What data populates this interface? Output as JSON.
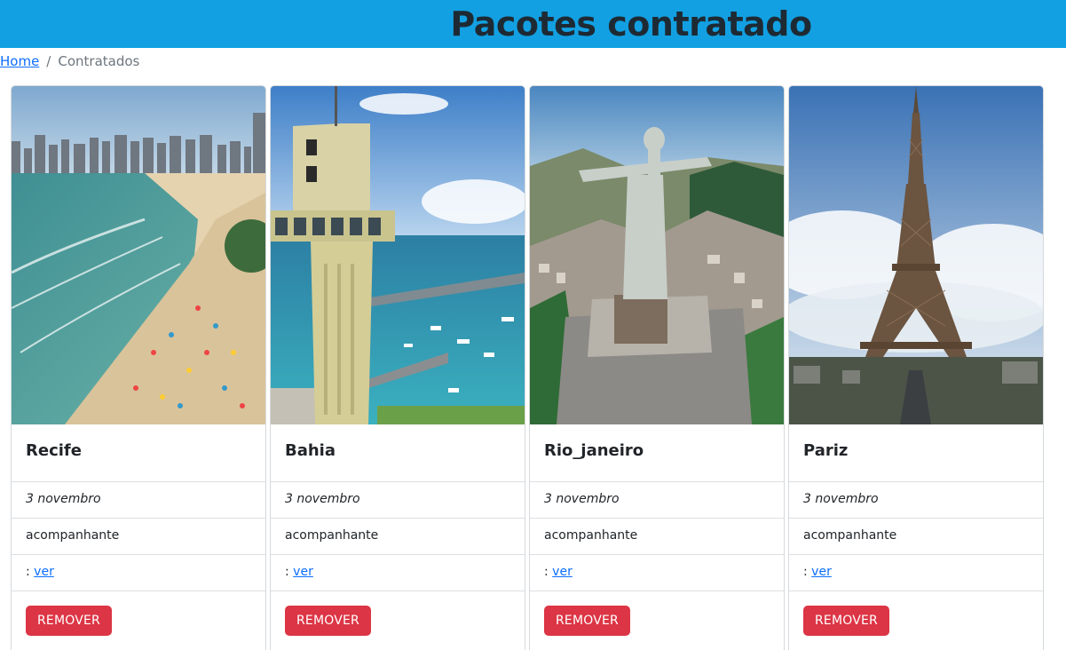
{
  "header": {
    "title": "Pacotes contratado"
  },
  "breadcrumb": {
    "home": "Home",
    "separator": "/",
    "current": "Contratados"
  },
  "cards": [
    {
      "title": "Recife",
      "date": "3 novembro",
      "companion": "acompanhante",
      "link_prefix": ":",
      "link_label": "ver",
      "button": "REMOVER",
      "image": "recife-beach-photo"
    },
    {
      "title": "Bahia",
      "date": "3 novembro",
      "companion": "acompanhante",
      "link_prefix": ":",
      "link_label": "ver",
      "button": "REMOVER",
      "image": "elevador-lacerda-photo"
    },
    {
      "title": "Rio_janeiro",
      "date": "3 novembro",
      "companion": "acompanhante",
      "link_prefix": ":",
      "link_label": "ver",
      "button": "REMOVER",
      "image": "cristo-redentor-photo"
    },
    {
      "title": "Pariz",
      "date": "3 novembro",
      "companion": "acompanhante",
      "link_prefix": ":",
      "link_label": "ver",
      "button": "REMOVER",
      "image": "eiffel-tower-photo"
    }
  ],
  "colors": {
    "header_bg": "#12a0e2",
    "remove_button": "#dc3545",
    "link": "#0d6efd"
  }
}
